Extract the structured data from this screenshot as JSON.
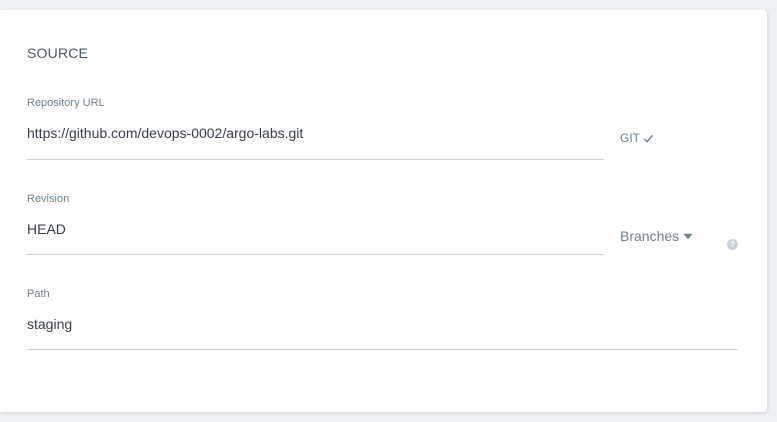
{
  "source": {
    "title": "SOURCE",
    "repository": {
      "label": "Repository URL",
      "value": "https://github.com/devops-0002/argo-labs.git",
      "type_label": "GIT",
      "type_icon": "check-icon"
    },
    "revision": {
      "label": "Revision",
      "value": "HEAD",
      "type_label": "Branches",
      "type_icon": "caret-down-icon",
      "help_icon": "question-icon",
      "help_glyph": "?"
    },
    "path": {
      "label": "Path",
      "value": "staging"
    }
  },
  "colors": {
    "page_background": "#eef1f4",
    "panel_background": "#ffffff",
    "text": "#363c4a",
    "muted": "#6d7f8b",
    "underline": "#c9d1d7"
  }
}
